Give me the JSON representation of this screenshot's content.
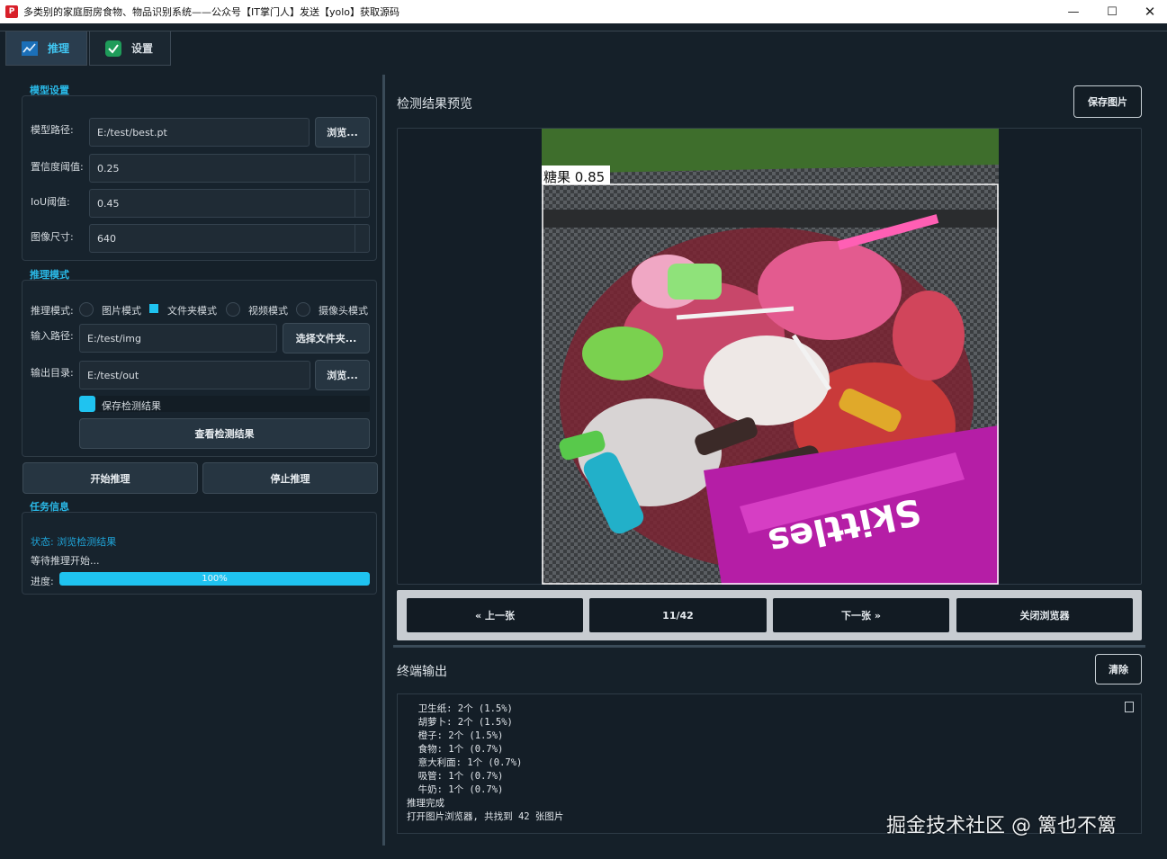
{
  "window": {
    "title": "多类别的家庭厨房食物、物品识别系统——公众号【IT掌门人】发送【yolo】获取源码",
    "icon": "app-logo-icon",
    "controls": [
      "minimize-icon",
      "maximize-icon",
      "close-icon"
    ]
  },
  "tabs": [
    {
      "label": "推理",
      "icon": "chart-line-icon",
      "active": true
    },
    {
      "label": "设置",
      "icon": "check-shield-icon",
      "active": false
    }
  ],
  "model_settings": {
    "section_title": "模型设置",
    "model_path_label": "模型路径:",
    "model_path_value": "E:/test/best.pt",
    "browse_label": "浏览...",
    "conf_label": "置信度阈值:",
    "conf_value": "0.25",
    "iou_label": "IoU阈值:",
    "iou_value": "0.45",
    "imgsz_label": "图像尺寸:",
    "imgsz_value": "640"
  },
  "infer_mode": {
    "section_title": "推理模式",
    "mode_label": "推理模式:",
    "modes": [
      {
        "label": "图片模式",
        "selected": false
      },
      {
        "label": "文件夹模式",
        "selected": true
      },
      {
        "label": "视频模式",
        "selected": false
      },
      {
        "label": "摄像头模式",
        "selected": false
      }
    ],
    "input_label": "输入路径:",
    "input_value": "E:/test/img",
    "select_folder_label": "选择文件夹...",
    "output_label": "输出目录:",
    "output_value": "E:/test/out",
    "browse_label": "浏览...",
    "save_results_label": "保存检测结果",
    "save_results_checked": true,
    "view_results_label": "查看检测结果"
  },
  "actions": {
    "start_label": "开始推理",
    "stop_label": "停止推理"
  },
  "task_info": {
    "section_title": "任务信息",
    "status_text": "状态: 浏览检测结果",
    "waiting_text": "等待推理开始...",
    "progress_label": "进度:",
    "progress_value": 1.0,
    "progress_text": "100%"
  },
  "preview": {
    "title": "检测结果预览",
    "save_image_label": "保存图片",
    "detection_label": "糖果 0.85",
    "image_subject": "pile of candies and lollipops on a woven chair"
  },
  "navigation": {
    "prev_label": "« 上一张",
    "counter": "11/42",
    "next_label": "下一张 »",
    "close_label": "关闭浏览器"
  },
  "terminal": {
    "title": "终端输出",
    "clear_label": "清除",
    "lines": [
      "  卫生纸: 2个 (1.5%)",
      "  胡萝卜: 2个 (1.5%)",
      "  橙子: 2个 (1.5%)",
      "  食物: 1个 (0.7%)",
      "  意大利面: 1个 (0.7%)",
      "  吸管: 1个 (0.7%)",
      "  牛奶: 1个 (0.7%)",
      "推理完成",
      "打开图片浏览器, 共找到 42 张图片"
    ]
  },
  "watermark": "掘金技术社区 @ 篱也不篱",
  "colors": {
    "background": "#152029",
    "accent": "#1fc3f0",
    "section_title": "#2ab8e6",
    "detection_box": "#ffffff"
  }
}
